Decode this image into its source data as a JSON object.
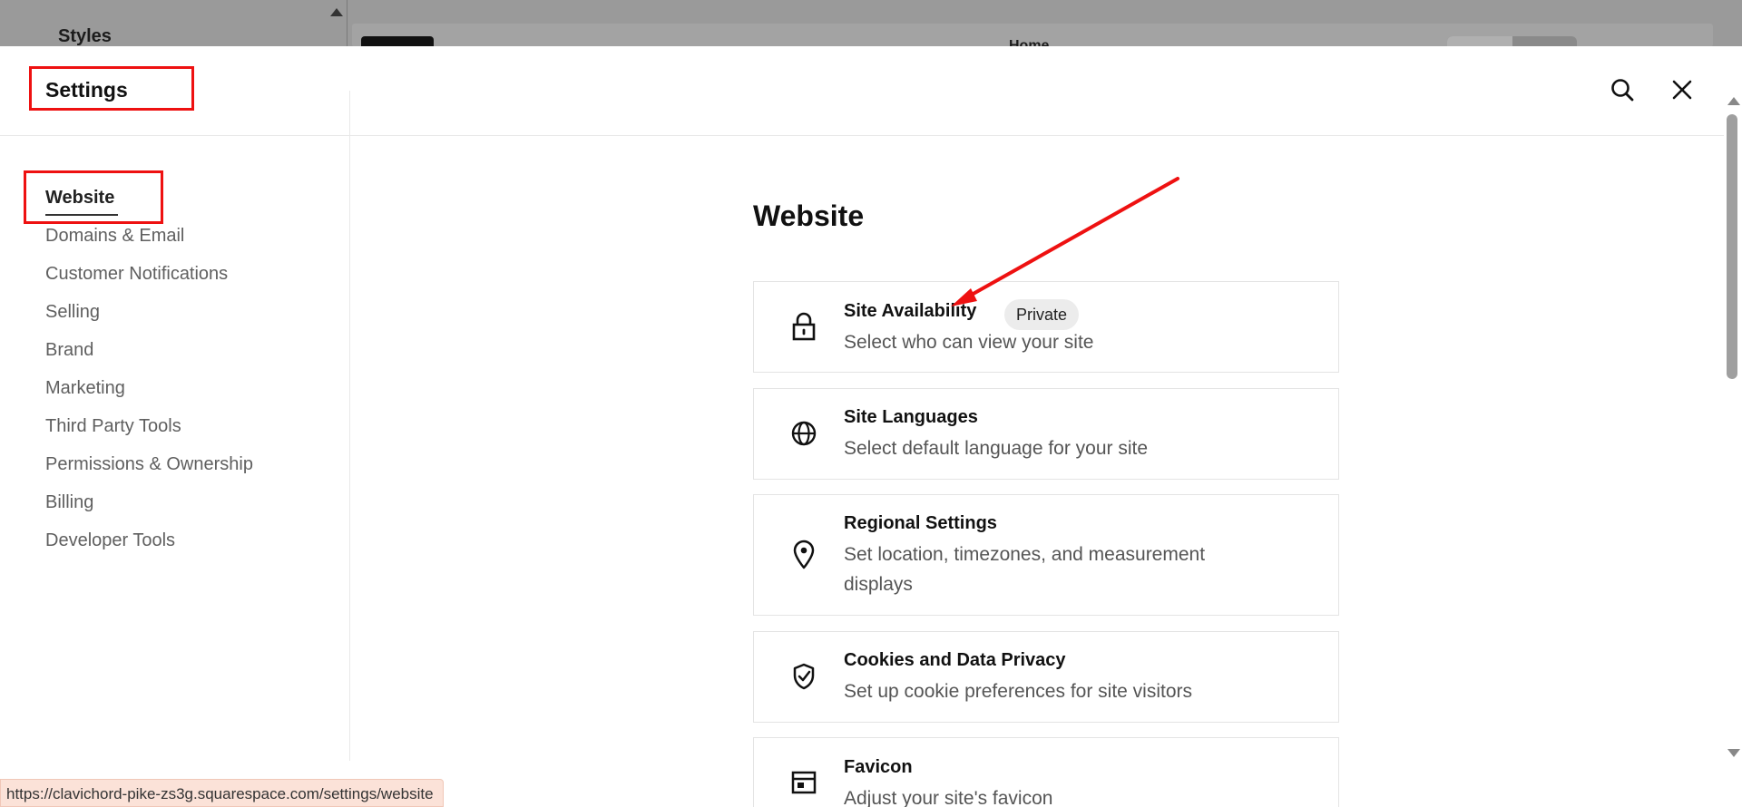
{
  "background": {
    "styles_label": "Styles",
    "home_label": "Home"
  },
  "header": {
    "title": "Settings",
    "search_icon": "search-icon",
    "close_icon": "close-icon"
  },
  "sidebar": {
    "items": [
      {
        "label": "Website",
        "active": true
      },
      {
        "label": "Domains & Email"
      },
      {
        "label": "Customer Notifications"
      },
      {
        "label": "Selling"
      },
      {
        "label": "Brand"
      },
      {
        "label": "Marketing"
      },
      {
        "label": "Third Party Tools"
      },
      {
        "label": "Permissions & Ownership"
      },
      {
        "label": "Billing"
      },
      {
        "label": "Developer Tools"
      }
    ]
  },
  "main": {
    "title": "Website",
    "cards": [
      {
        "title": "Site Availability",
        "badge": "Private",
        "description": "Select who can view your site",
        "icon": "lock-icon"
      },
      {
        "title": "Site Languages",
        "description": "Select default language for your site",
        "icon": "globe-icon"
      },
      {
        "title": "Regional Settings",
        "description": "Set location, timezones, and measurement displays",
        "icon": "location-pin-icon"
      },
      {
        "title": "Cookies and Data Privacy",
        "description": "Set up cookie preferences for site visitors",
        "icon": "shield-check-icon"
      },
      {
        "title": "Favicon",
        "description": "Adjust your site's favicon",
        "icon": "browser-window-icon"
      }
    ]
  },
  "status_bar": {
    "url": "https://clavichord-pike-zs3g.squarespace.com/settings/website"
  },
  "colors": {
    "annotation": "#ee1111",
    "status_bar_bg": "#fbe2d8"
  }
}
